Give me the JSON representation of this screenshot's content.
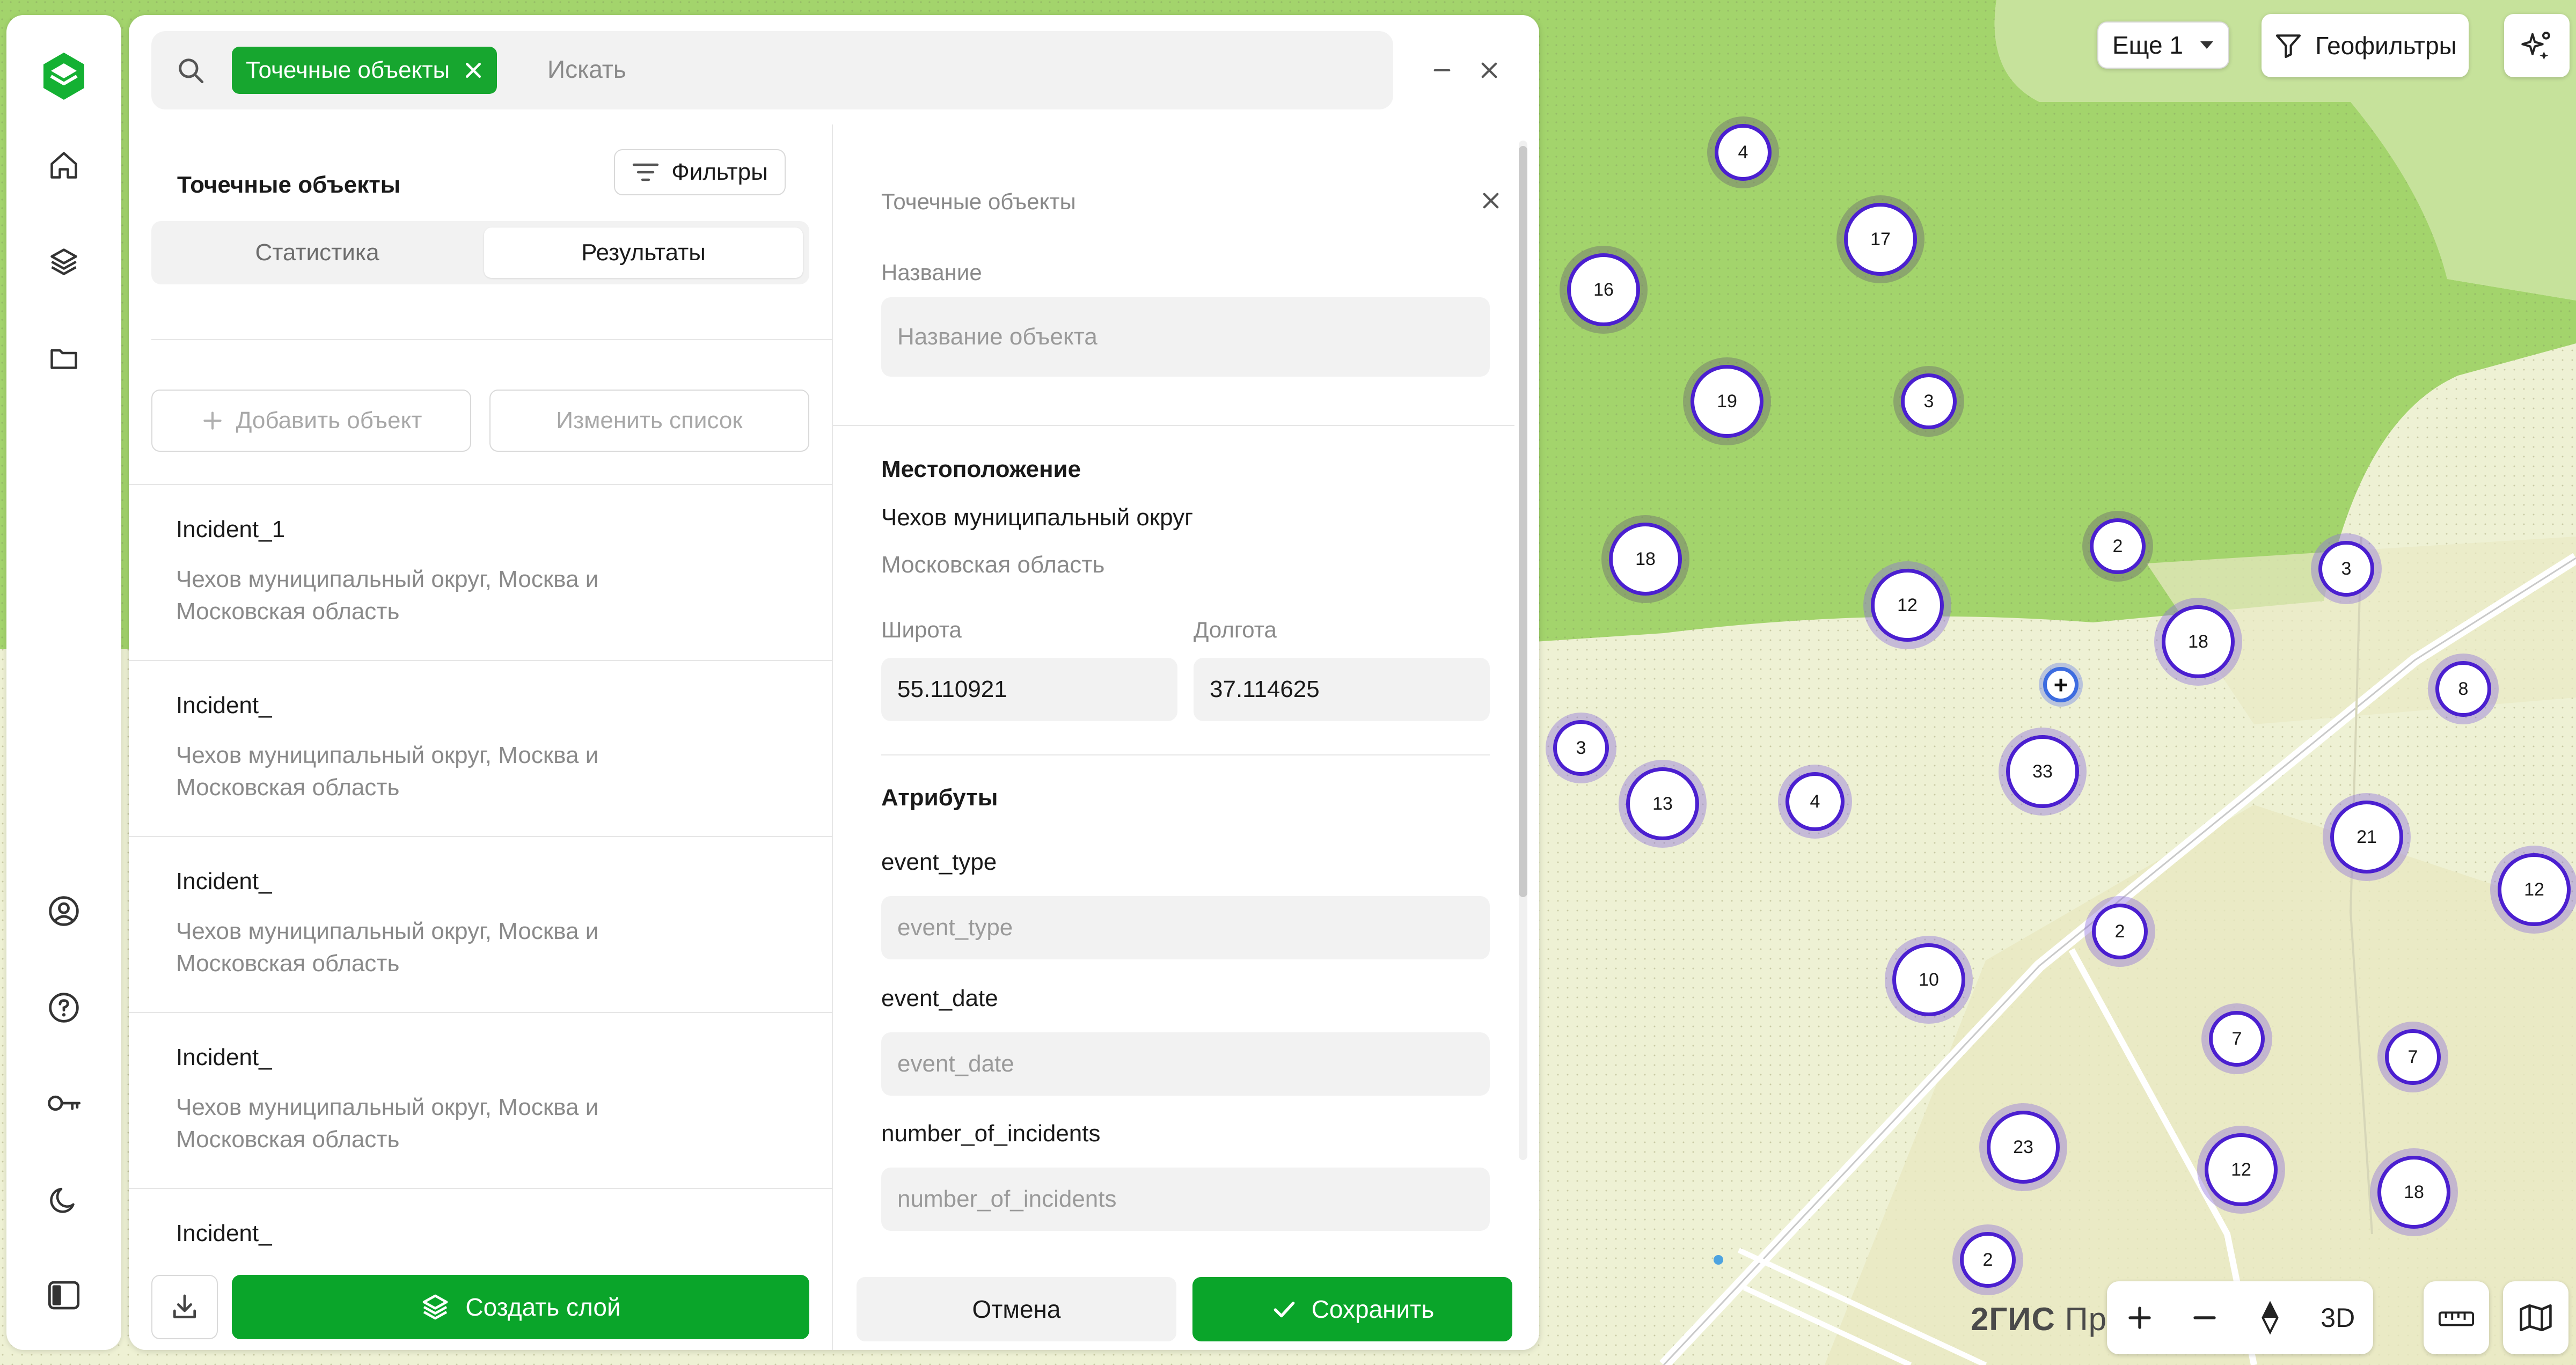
{
  "search": {
    "chip_label": "Точечные объекты",
    "placeholder": "Искать"
  },
  "left_panel": {
    "title": "Точечные объекты",
    "filters_label": "Фильтры",
    "tabs": [
      {
        "label": "Статистика",
        "active": false
      },
      {
        "label": "Результаты",
        "active": true
      }
    ],
    "add_object_label": "Добавить объект",
    "edit_list_label": "Изменить список",
    "items": [
      {
        "title": "Incident_1",
        "subtitle": "Чехов муниципальный округ, Москва и Московская область"
      },
      {
        "title": "Incident_",
        "subtitle": "Чехов муниципальный округ, Москва и Московская область"
      },
      {
        "title": "Incident_",
        "subtitle": "Чехов муниципальный округ, Москва и Московская область"
      },
      {
        "title": "Incident_",
        "subtitle": "Чехов муниципальный округ, Москва и Московская область"
      },
      {
        "title": "Incident_",
        "subtitle": ""
      }
    ],
    "create_layer_label": "Создать слой"
  },
  "right_panel": {
    "header": "Точечные объекты",
    "name_label": "Название",
    "name_placeholder": "Название объекта",
    "location_title": "Местоположение",
    "location_primary": "Чехов муниципальный округ",
    "location_secondary": "Московская область",
    "lat_label": "Широта",
    "lat_value": "55.110921",
    "lon_label": "Долгота",
    "lon_value": "37.114625",
    "attributes_title": "Атрибуты",
    "attributes": [
      {
        "label": "event_type",
        "placeholder": "event_type"
      },
      {
        "label": "event_date",
        "placeholder": "event_date"
      },
      {
        "label": "number_of_incidents",
        "placeholder": "number_of_incidents"
      }
    ],
    "cancel_label": "Отмена",
    "save_label": "Сохранить"
  },
  "map": {
    "more_select": "Еще 1",
    "geofilter_label": "Геофильтры",
    "brand_bold": "2ГИС",
    "brand_light": "Про",
    "view_3d_label": "3D",
    "clusters": [
      "4",
      "17",
      "16",
      "19",
      "3",
      "18",
      "2",
      "12",
      "3",
      "18",
      "8",
      "3",
      "13",
      "4",
      "33",
      "21",
      "12",
      "2",
      "10",
      "7",
      "7",
      "23",
      "12",
      "18",
      "2"
    ]
  },
  "colors": {
    "accent_green": "#0aa52a",
    "cluster_border": "#4b1fd0",
    "forest": "#9fd46a",
    "field": "#eff2d6"
  }
}
